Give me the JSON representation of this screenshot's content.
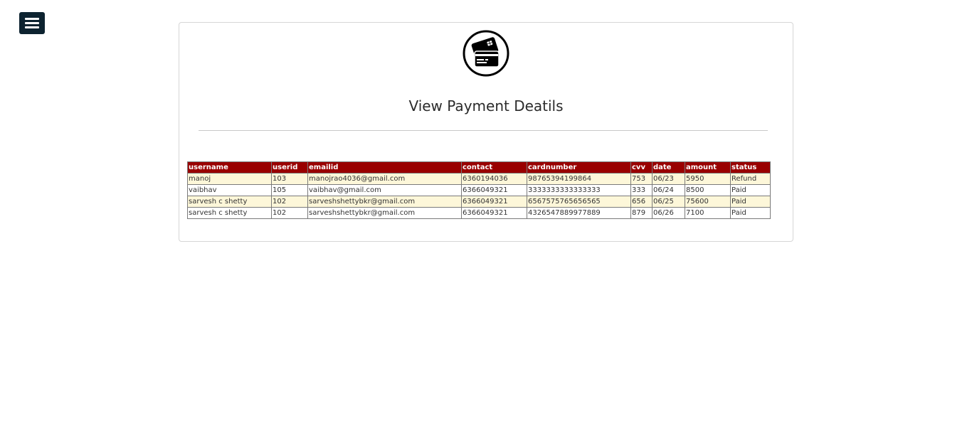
{
  "header": {
    "menu_icon": "hamburger-menu-icon"
  },
  "card": {
    "logo_icon": "credit-card-icon",
    "title": "View Payment Deatils"
  },
  "table": {
    "columns": [
      "username",
      "userid",
      "emailid",
      "contact",
      "cardnumber",
      "cvv",
      "date",
      "amount",
      "status"
    ],
    "rows": [
      [
        "manoj",
        "103",
        "manojrao4036@gmail.com",
        "6360194036",
        "98765394199864",
        "753",
        "06/23",
        "5950",
        "Refund"
      ],
      [
        "vaibhav",
        "105",
        "vaibhav@gmail.com",
        "6366049321",
        "3333333333333333",
        "333",
        "06/24",
        "8500",
        "Paid"
      ],
      [
        "sarvesh c shetty",
        "102",
        "sarveshshettybkr@gmail.com",
        "6366049321",
        "6567575765656565",
        "656",
        "06/25",
        "75600",
        "Paid"
      ],
      [
        "sarvesh c shetty",
        "102",
        "sarveshshettybkr@gmail.com",
        "6366049321",
        "4326547889977889",
        "879",
        "06/26",
        "7100",
        "Paid"
      ]
    ]
  },
  "colors": {
    "header_bg": "#990000",
    "odd_row_bg": "#fdf7d9",
    "menu_bg": "#0d2330"
  }
}
